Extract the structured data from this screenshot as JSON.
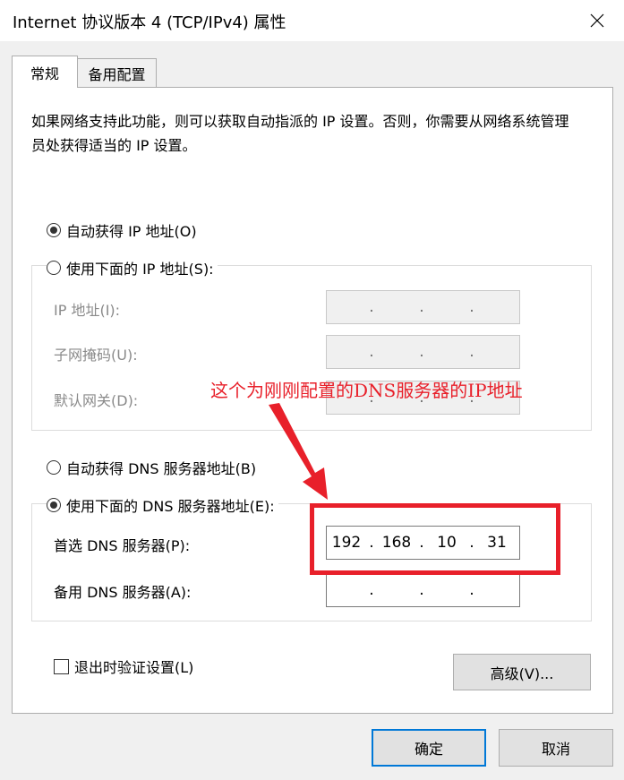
{
  "window": {
    "title": "Internet 协议版本 4 (TCP/IPv4) 属性"
  },
  "tabs": [
    {
      "label": "常规",
      "selected": true
    },
    {
      "label": "备用配置",
      "selected": false
    }
  ],
  "description": "如果网络支持此功能，则可以获取自动指派的 IP 设置。否则，你需要从网络系统管理员处获得适当的 IP 设置。",
  "ip_section": {
    "auto_radio_label": "自动获得 IP 地址(O)",
    "auto_selected": true,
    "manual_radio_label": "使用下面的 IP 地址(S):",
    "manual_selected": false,
    "fields": [
      {
        "label": "IP 地址(I):",
        "value": [
          "",
          "",
          "",
          ""
        ]
      },
      {
        "label": "子网掩码(U):",
        "value": [
          "",
          "",
          "",
          ""
        ]
      },
      {
        "label": "默认网关(D):",
        "value": [
          "",
          "",
          "",
          ""
        ]
      }
    ]
  },
  "dns_section": {
    "auto_radio_label": "自动获得 DNS 服务器地址(B)",
    "auto_selected": false,
    "manual_radio_label": "使用下面的 DNS 服务器地址(E):",
    "manual_selected": true,
    "fields": [
      {
        "label": "首选 DNS 服务器(P):",
        "value": [
          "192",
          "168",
          "10",
          "31"
        ]
      },
      {
        "label": "备用 DNS 服务器(A):",
        "value": [
          "",
          "",
          "",
          ""
        ]
      }
    ]
  },
  "validate_checkbox": {
    "label": "退出时验证设置(L)",
    "checked": false
  },
  "buttons": {
    "advanced": "高级(V)...",
    "ok": "确定",
    "cancel": "取消"
  },
  "annotation": {
    "text": "这个为刚刚配置的DNS服务器的IP地址",
    "color": "#e8202a"
  },
  "colors": {
    "accent": "#0078d7",
    "annotation_red": "#e8202a"
  }
}
